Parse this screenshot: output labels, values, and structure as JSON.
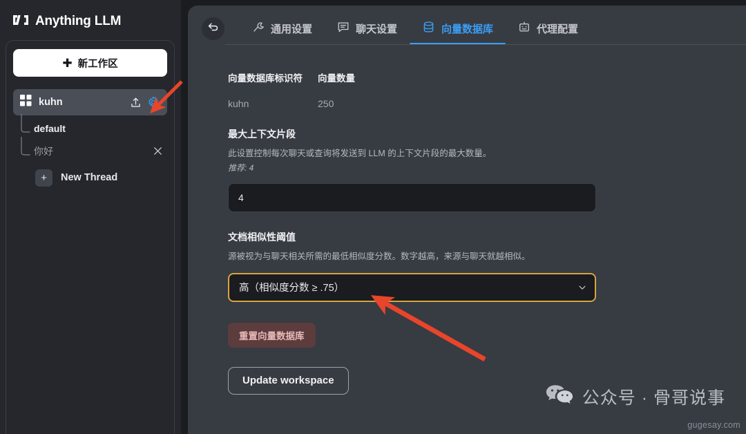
{
  "brand": {
    "name": "Anything LLM",
    "logo_icon": "anythingllm-logo-icon"
  },
  "sidebar": {
    "new_workspace_label": "新工作区",
    "new_workspace_icon": "plus-icon",
    "workspace": {
      "name": "kuhn",
      "grid_icon": "grid-squares-icon",
      "upload_icon": "upload-icon",
      "settings_icon": "gear-icon"
    },
    "threads": [
      {
        "label": "default",
        "state": "active",
        "closable": false
      },
      {
        "label": "你好",
        "state": "muted",
        "closable": true,
        "close_icon": "close-x-icon"
      }
    ],
    "new_thread": {
      "label": "New Thread",
      "icon": "plus-icon"
    }
  },
  "main": {
    "back_button": {
      "icon": "back-arrow-icon"
    },
    "tabs": [
      {
        "label": "通用设置",
        "icon": "wrench-icon",
        "active": false
      },
      {
        "label": "聊天设置",
        "icon": "chat-bubble-icon",
        "active": false
      },
      {
        "label": "向量数据库",
        "icon": "database-icon",
        "active": true
      },
      {
        "label": "代理配置",
        "icon": "robot-icon",
        "active": false
      }
    ],
    "info_columns": [
      {
        "header": "向量数据库标识符",
        "value": "kuhn"
      },
      {
        "header": "向量数量",
        "value": "250"
      }
    ],
    "max_context": {
      "title": "最大上下文片段",
      "description": "此设置控制每次聊天或查询将发送到 LLM 的上下文片段的最大数量。",
      "recommendation": "推荐: 4",
      "value": "4"
    },
    "similarity": {
      "title": "文档相似性阈值",
      "description": "源被视为与聊天相关所需的最低相似度分数。数字越高，来源与聊天就越相似。",
      "selected": "高（相似度分数 ≥ .75）",
      "chevron_icon": "chevron-down-icon"
    },
    "reset_button": "重置向量数据库",
    "update_button": "Update workspace"
  },
  "watermark": {
    "icon": "wechat-icon",
    "text": "公众号 · 骨哥说事",
    "url": "gugesay.com"
  },
  "colors": {
    "accent_blue": "#3b9df5",
    "focus_gold": "#d9a441",
    "annotation_red": "#e8452a",
    "danger_bg": "#5c3c3c",
    "sidebar_bg": "#25272c",
    "panel_bg": "#373b42"
  }
}
